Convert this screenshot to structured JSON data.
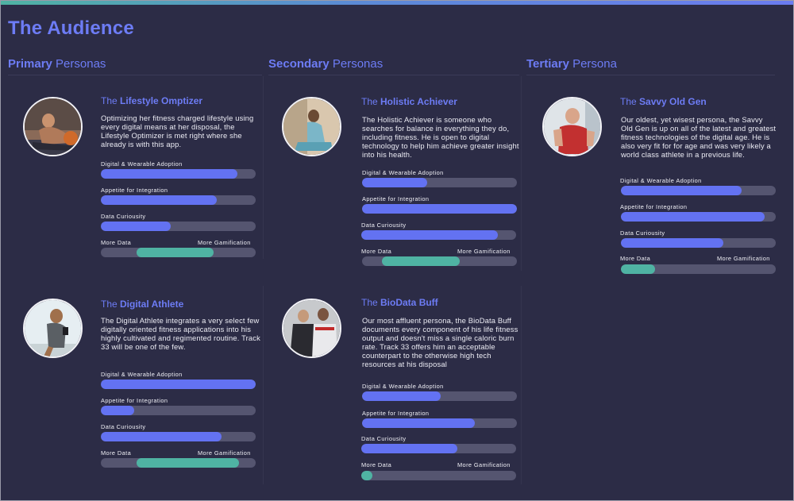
{
  "page": {
    "title": "The Audience"
  },
  "columns": [
    {
      "bold": "Primary",
      "light": " Personas"
    },
    {
      "bold": "Secondary",
      "light": " Personas"
    },
    {
      "bold": "Tertiary",
      "light": " Persona"
    }
  ],
  "metric_labels": {
    "adoption": "Digital & Wearable Adoption",
    "integration": "Appetite for Integration",
    "curiosity": "Data Curiousity",
    "left": "More Data",
    "right": "More Gamification"
  },
  "personas": [
    {
      "prefix": "The ",
      "name": "Lifestyle Omptizer",
      "desc": "Optimizing her fitness charged lifestyle using every digital means at her disposal, the Lifestyle Optimizer is met right where she already is with this app.",
      "adoption": 0.88,
      "integration": 0.75,
      "curiosity": 0.45,
      "data_gamification": {
        "start": 0.23,
        "end": 0.73
      },
      "avatar_icon": "woman-stretching-photo"
    },
    {
      "prefix": "The ",
      "name": "Digital Athlete",
      "desc": "The Digital Athlete integrates a very select few digitally oriented fitness applications into his highly cultivated and regimented routine. Track 33 will be one of the few.",
      "adoption": 1.0,
      "integration": 0.21,
      "curiosity": 0.78,
      "data_gamification": {
        "start": 0.23,
        "end": 0.89
      },
      "avatar_icon": "runner-photo"
    },
    {
      "prefix": "The ",
      "name": "Holistic Achiever",
      "desc": "The Holistic Achiever is someone who searches for balance in everything they do, including fitness. He is open to digital technology to help him achieve greater insight into his health.",
      "adoption": 0.42,
      "integration": 1.0,
      "curiosity": 0.88,
      "data_gamification": {
        "start": 0.13,
        "end": 0.63
      },
      "avatar_icon": "man-yoga-photo"
    },
    {
      "prefix": "The ",
      "name": "BioData Buff",
      "desc": "Our most affluent persona, the BioData Buff documents every component of his life fitness output and doesn't miss a single caloric burn rate. Track 33 offers him an acceptable counterpart to the otherwise high tech resources at his disposal",
      "adoption": 0.51,
      "integration": 0.73,
      "curiosity": 0.62,
      "data_gamification": {
        "start": 0.0,
        "end": 0.07
      },
      "avatar_icon": "trainer-and-client-photo"
    },
    {
      "prefix": "The ",
      "name": "Savvy Old Gen",
      "desc": "Our oldest, yet wisest persona, the Savvy Old Gen is up on all of the latest and greatest fitness technologies of the digital age. He is also very fit for for age and was very likely a world class athlete in a previous life.",
      "adoption": 0.78,
      "integration": 0.93,
      "curiosity": 0.66,
      "data_gamification": {
        "start": 0.0,
        "end": 0.22
      },
      "avatar_icon": "older-man-photo"
    }
  ]
}
